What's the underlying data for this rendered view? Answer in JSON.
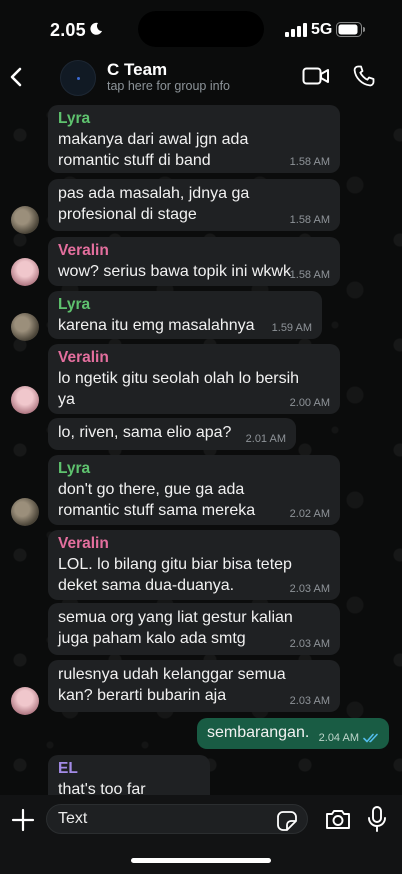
{
  "status_bar": {
    "time": "2.05",
    "network": "5G"
  },
  "header": {
    "title": "C Team",
    "subtitle": "tap here for group info"
  },
  "colors": {
    "lyra": "#5ec26e",
    "veralin": "#e46f9e",
    "el": "#a38be6",
    "read_ticks": "#53bdeb"
  },
  "messages": [
    {
      "sender": "Lyra",
      "text": "makanya dari awal jgn ada\nromantic stuff di band",
      "time": "1.58 AM"
    },
    {
      "text": "pas ada masalah, jdnya ga\nprofesional di stage",
      "time": "1.58 AM"
    },
    {
      "sender": "Veralin",
      "text": "wow? serius bawa topik ini wkwk",
      "time": "1.58 AM"
    },
    {
      "sender": "Lyra",
      "text": "karena itu emg masalahnya",
      "time": "1.59 AM"
    },
    {
      "sender": "Veralin",
      "text": "lo ngetik gitu seolah olah lo bersih\nya",
      "time": "2.00 AM"
    },
    {
      "text": "lo, riven, sama elio apa?",
      "time": "2.01 AM"
    },
    {
      "sender": "Lyra",
      "text": "don't go there, gue ga ada\nromantic stuff sama mereka",
      "time": "2.02 AM"
    },
    {
      "sender": "Veralin",
      "text": "LOL. lo bilang gitu biar bisa tetep\ndeket sama dua-duanya.",
      "time": "2.03 AM"
    },
    {
      "text": "semua org yang liat gestur kalian\njuga paham kalo ada smtg",
      "time": "2.03 AM"
    },
    {
      "text": "rulesnya udah kelanggar semua\nkan? berarti bubarin aja",
      "time": "2.03 AM"
    },
    {
      "text": "sembarangan.",
      "time": "2.04 AM"
    },
    {
      "sender": "EL",
      "text": "that's too far"
    }
  ],
  "input": {
    "placeholder": "Text"
  }
}
